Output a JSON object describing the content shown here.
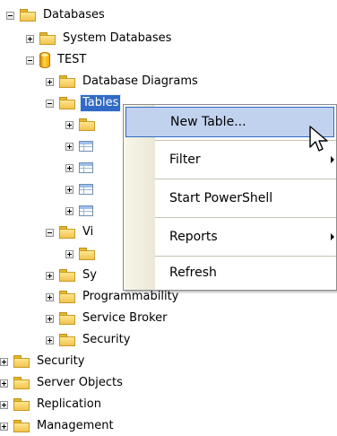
{
  "tree": {
    "nodes": [
      {
        "label": "Databases",
        "display_label": "Databases",
        "level": 0,
        "state": "expanded",
        "icon": "folder-icon"
      },
      {
        "label": "System Databases",
        "display_label": "System Databases",
        "level": 1,
        "state": "collapsed",
        "icon": "folder-icon"
      },
      {
        "label": "TEST",
        "display_label": "TEST",
        "level": 1,
        "state": "expanded",
        "icon": "database-icon"
      },
      {
        "label": "Database Diagrams",
        "display_label": "Database Diagrams",
        "level": 2,
        "state": "collapsed",
        "icon": "folder-icon"
      },
      {
        "label": "Tables",
        "display_label": "Tables",
        "level": 2,
        "state": "expanded",
        "icon": "folder-icon",
        "selected": true
      },
      {
        "label": "",
        "display_label": "",
        "level": 3,
        "state": "collapsed",
        "icon": "folder-icon"
      },
      {
        "label": "",
        "display_label": "",
        "level": 3,
        "state": "collapsed",
        "icon": "table-icon"
      },
      {
        "label": "",
        "display_label": "",
        "level": 3,
        "state": "collapsed",
        "icon": "table-icon"
      },
      {
        "label": "",
        "display_label": "",
        "level": 3,
        "state": "collapsed",
        "icon": "table-icon"
      },
      {
        "label": "",
        "display_label": "",
        "level": 3,
        "state": "collapsed",
        "icon": "table-icon"
      },
      {
        "label": "Vi",
        "display_label": "Vi",
        "level": 2,
        "state": "expanded",
        "icon": "folder-icon",
        "partial": "vi"
      },
      {
        "label": "",
        "display_label": "",
        "level": 3,
        "state": "collapsed",
        "icon": "folder-icon"
      },
      {
        "label": "Sy",
        "display_label": "Sy",
        "level": 2,
        "state": "collapsed",
        "icon": "folder-icon",
        "partial": "sy"
      },
      {
        "label": "Programmability",
        "display_label": "Programmability",
        "level": 2,
        "state": "collapsed",
        "icon": "folder-icon"
      },
      {
        "label": "Service Broker",
        "display_label": "Service Broker",
        "level": 2,
        "state": "collapsed",
        "icon": "folder-icon"
      },
      {
        "label": "Security",
        "display_label": "Security",
        "level": 2,
        "state": "collapsed",
        "icon": "folder-icon"
      },
      {
        "label": "Security",
        "display_label": "Security",
        "level": 0,
        "state": "collapsed",
        "icon": "folder-icon"
      },
      {
        "label": "Server Objects",
        "display_label": "Server Objects",
        "level": 0,
        "state": "collapsed",
        "icon": "folder-icon"
      },
      {
        "label": "Replication",
        "display_label": "Replication",
        "level": 0,
        "state": "collapsed",
        "icon": "folder-icon"
      },
      {
        "label": "Management",
        "display_label": "Management",
        "level": 0,
        "state": "collapsed",
        "icon": "folder-icon"
      }
    ]
  },
  "context_menu": {
    "items": [
      {
        "label": "New Table...",
        "highlighted": true,
        "has_submenu": false
      },
      {
        "label": "Filter",
        "highlighted": false,
        "has_submenu": true
      },
      {
        "label": "Start PowerShell",
        "highlighted": false,
        "has_submenu": false
      },
      {
        "label": "Reports",
        "highlighted": false,
        "has_submenu": true
      },
      {
        "label": "Refresh",
        "highlighted": false,
        "has_submenu": false
      }
    ]
  },
  "colors": {
    "selection": "#316ac5",
    "menu_highlight": "#c1d2ee",
    "folder": "#f2c34f"
  }
}
